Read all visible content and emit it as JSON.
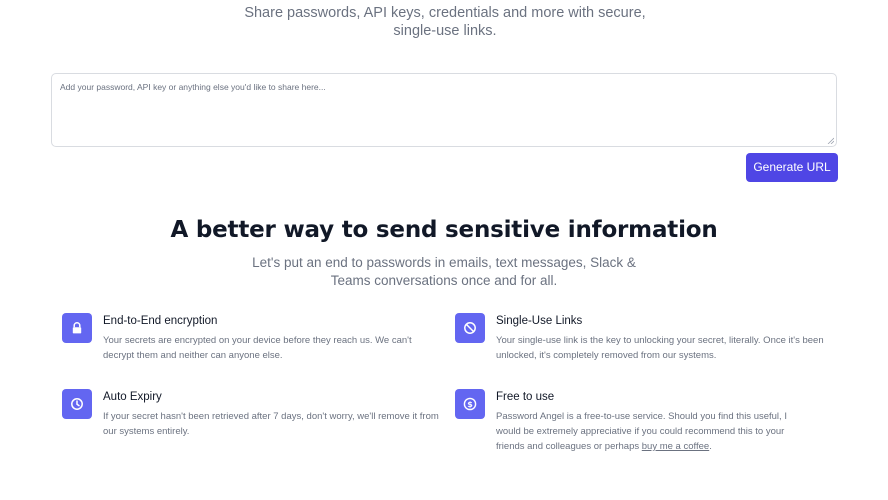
{
  "hero": {
    "subtitle": "Share passwords, API keys, credentials and more with secure, single-use links."
  },
  "secret_form": {
    "placeholder": "Add your password, API key or anything else you'd like to share here...",
    "value": "",
    "generate_label": "Generate URL"
  },
  "section": {
    "title": "A better way to send sensitive information",
    "lead": "Let's put an end to passwords in emails, text messages, Slack & Teams conversations once and for all."
  },
  "features": [
    {
      "icon": "lock-icon",
      "title": "End-to-End encryption",
      "body": "Your secrets are encrypted on your device before they reach us. We can't decrypt them and neither can anyone else."
    },
    {
      "icon": "block-icon",
      "title": "Single-Use Links",
      "body": "Your single-use link is the key to unlocking your secret, literally. Once it's been unlocked, it's completely removed from our systems."
    },
    {
      "icon": "clock-icon",
      "title": "Auto Expiry",
      "body": "If your secret hasn't been retrieved after 7 days, don't worry, we'll remove it from our systems entirely."
    },
    {
      "icon": "dollar-icon",
      "title": "Free to use",
      "body_prefix": "Password Angel is a free-to-use service. Should you find this useful, I would be extremely appreciative if you could recommend this to your friends and colleagues or perhaps ",
      "link_label": "buy me a coffee",
      "body_suffix": "."
    }
  ],
  "colors": {
    "accent": "#4f46e5",
    "icon_tile": "#6366f1",
    "heading": "#111827",
    "muted_text": "#6b7280",
    "border": "#d9dce1"
  }
}
